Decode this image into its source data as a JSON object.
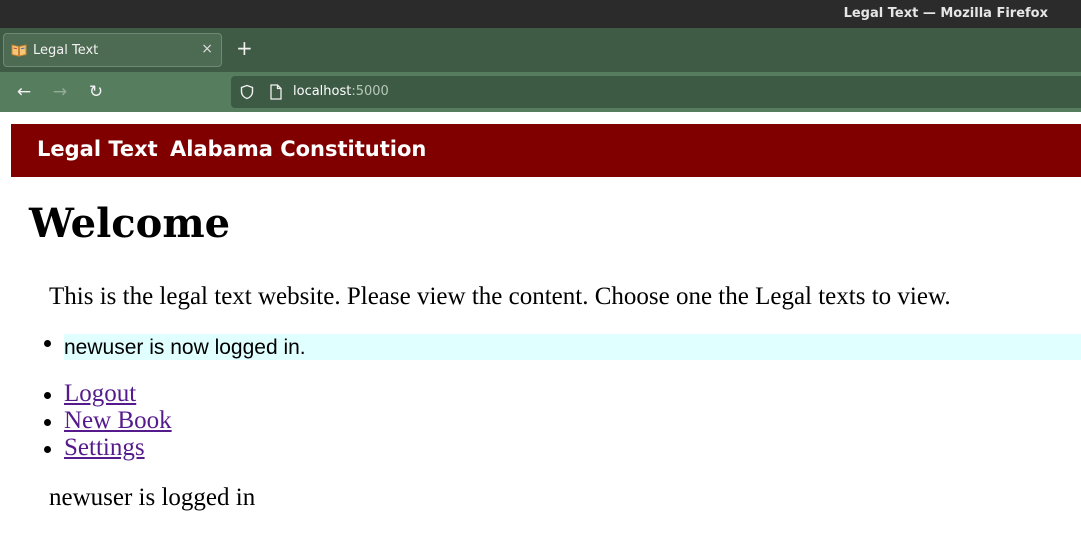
{
  "window": {
    "title": "Legal Text — Mozilla Firefox"
  },
  "tabs": [
    {
      "label": "Legal Text",
      "close": "×"
    }
  ],
  "newtab": "+",
  "nav": {
    "back": "←",
    "forward": "→",
    "reload": "↻"
  },
  "address": {
    "host": "localhost",
    "port": ":5000"
  },
  "site_nav": {
    "brand": "Legal Text",
    "link": "Alabama Constitution"
  },
  "main": {
    "heading": "Welcome",
    "intro": "This is the legal text website. Please view the content. Choose one the Legal texts to view.",
    "flash": "newuser is now logged in.",
    "links": [
      "Logout",
      "New Book",
      "Settings"
    ],
    "status": "newuser is logged in"
  },
  "colors": {
    "header_bg": "#800000",
    "flash_bg": "#e0ffff",
    "link": "#551a8b",
    "tabstrip": "#3f5b45",
    "navbar": "#577d5f"
  },
  "icons": [
    "book-favicon-icon",
    "close-icon",
    "plus-icon",
    "back-arrow-icon",
    "forward-arrow-icon",
    "reload-icon",
    "shield-icon",
    "page-icon"
  ]
}
